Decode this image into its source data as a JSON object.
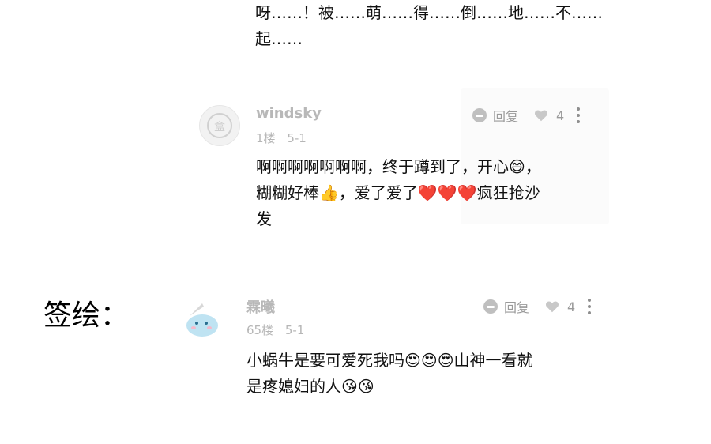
{
  "top_comment": {
    "line1": "呀……！被……萌……得……倒……地……不……",
    "line2": "起……"
  },
  "comment1": {
    "username": "windsky",
    "floor": "1楼",
    "date": "5-1",
    "reply_label": "回复",
    "like_count": "4",
    "line1": "啊啊啊啊啊啊啊，终于蹲到了，开心😄，",
    "line2": "糊糊好棒👍，爱了爱了❤️❤️❤️疯狂抢沙",
    "line3": "发"
  },
  "signature_label": "签绘：",
  "comment2": {
    "username": "霖曦",
    "floor": "65楼",
    "date": "5-1",
    "reply_label": "回复",
    "like_count": "4",
    "line1": "小蜗牛是要可爱死我吗😍😍😍山神一看就",
    "line2": "是疼媳妇的人😘😘"
  },
  "colors": {
    "text": "#111111",
    "muted": "#b8b8b8",
    "icon": "#bfbfbf"
  }
}
